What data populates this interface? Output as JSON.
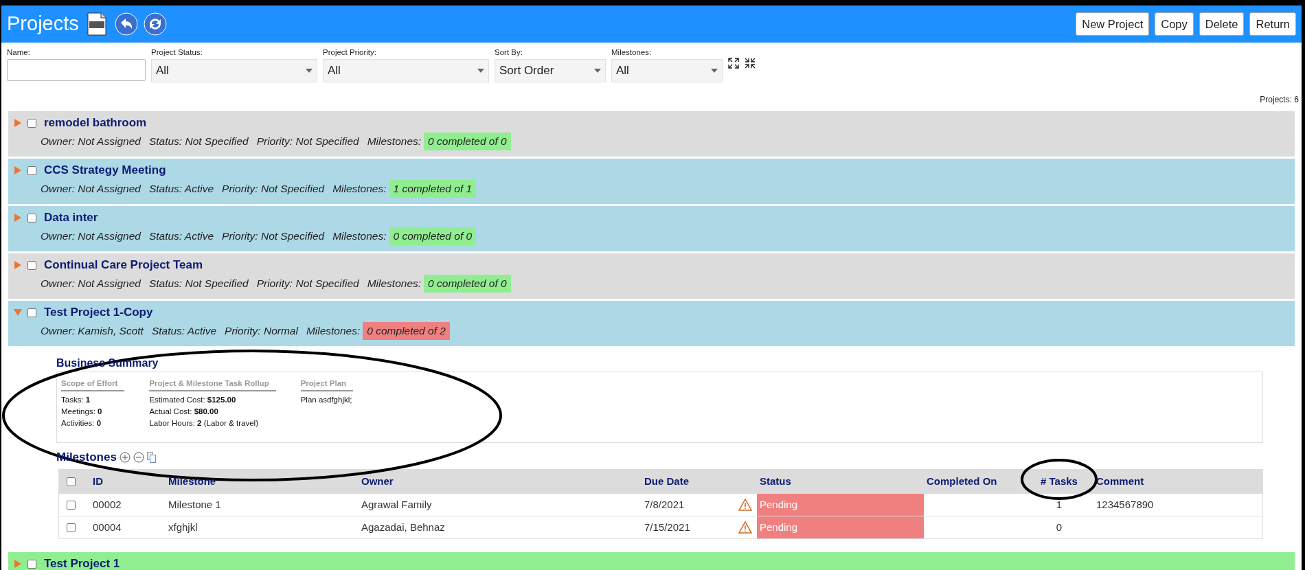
{
  "header": {
    "title": "Projects",
    "buttons": [
      "New Project",
      "Copy",
      "Delete",
      "Return"
    ]
  },
  "filters": [
    {
      "kind": "text",
      "label": "Name:"
    },
    {
      "kind": "select",
      "label": "Project Status:",
      "value": "All"
    },
    {
      "kind": "select",
      "label": "Project Priority:",
      "value": "All"
    },
    {
      "kind": "select",
      "label": "Sort By:",
      "value": "Sort Order"
    },
    {
      "kind": "select",
      "label": "Milestones:",
      "value": "All"
    }
  ],
  "project_count": "Projects: 6",
  "projects": [
    {
      "name": "remodel bathroom",
      "expanded": false,
      "checked": false,
      "color": "#dcdcdc",
      "owner": "Owner: Not Assigned",
      "status": "Status: Not Specified",
      "priority": "Priority: Not Specified",
      "milestones_label": "Milestones:",
      "milestones": {
        "text": "0 completed of 0",
        "color": "#90ee90"
      }
    },
    {
      "name": "CCS Strategy Meeting",
      "expanded": false,
      "checked": false,
      "color": "#add8e6",
      "owner": "Owner: Not Assigned",
      "status": "Status: Active",
      "priority": "Priority: Not Specified",
      "milestones_label": "Milestones:",
      "milestones": {
        "text": "1 completed of 1",
        "color": "#90ee90"
      }
    },
    {
      "name": "Data inter",
      "expanded": false,
      "checked": false,
      "color": "#add8e6",
      "owner": "Owner: Not Assigned",
      "status": "Status: Active",
      "priority": "Priority: Not Specified",
      "milestones_label": "Milestones:",
      "milestones": {
        "text": "0 completed of 0",
        "color": "#90ee90"
      }
    },
    {
      "name": "Continual Care Project Team",
      "expanded": false,
      "checked": false,
      "color": "#dcdcdc",
      "owner": "Owner: Not Assigned",
      "status": "Status: Not Specified",
      "priority": "Priority: Not Specified",
      "milestones_label": "Milestones:",
      "milestones": {
        "text": "0 completed of 0",
        "color": "#90ee90"
      }
    },
    {
      "name": "Test Project 1-Copy",
      "expanded": true,
      "checked": false,
      "color": "#add8e6",
      "owner": "Owner: Kamish, Scott",
      "status": "Status: Active",
      "priority": "Priority: Normal",
      "milestones_label": "Milestones:",
      "milestones": {
        "text": "0 completed of 2",
        "color": "#f08080"
      },
      "business_summary": {
        "title": "Business Summary",
        "sections": [
          {
            "title": "Scope of Effort",
            "lines": [
              "Tasks: **1**",
              "Meetings: **0**",
              "Activities: **0**"
            ]
          },
          {
            "title": "Project & Milestone Task Rollup",
            "lines": [
              "Estimated Cost: **$125.00**",
              "Actual Cost: **$80.00**",
              "Labor Hours: **2** (Labor & travel)"
            ]
          },
          {
            "title": "Project Plan",
            "lines": [
              "Plan asdfghjkl;"
            ]
          }
        ]
      },
      "milestone_table": {
        "title": "Milestones",
        "header_checked": false,
        "columns": [
          "ID",
          "Milestone",
          "Owner",
          "Due Date",
          "Status",
          "Completed On",
          "# Tasks",
          "Comment"
        ],
        "rows": [
          {
            "checked": false,
            "id": "00002",
            "milestone": "Milestone 1",
            "owner": "Agrawal Family",
            "due_date": "7/8/2021",
            "overdue": true,
            "status": "Pending",
            "color": "#f08080",
            "tasks": "1",
            "comment": "1234567890"
          },
          {
            "checked": false,
            "id": "00004",
            "milestone": "xfghjkl",
            "owner": "Agazadai, Behnaz",
            "due_date": "7/15/2021",
            "overdue": true,
            "status": "Pending",
            "color": "#f08080",
            "tasks": "0"
          }
        ]
      }
    },
    {
      "name": "Test Project 1",
      "expanded": false,
      "checked": false,
      "color": "#90ee90"
    }
  ]
}
